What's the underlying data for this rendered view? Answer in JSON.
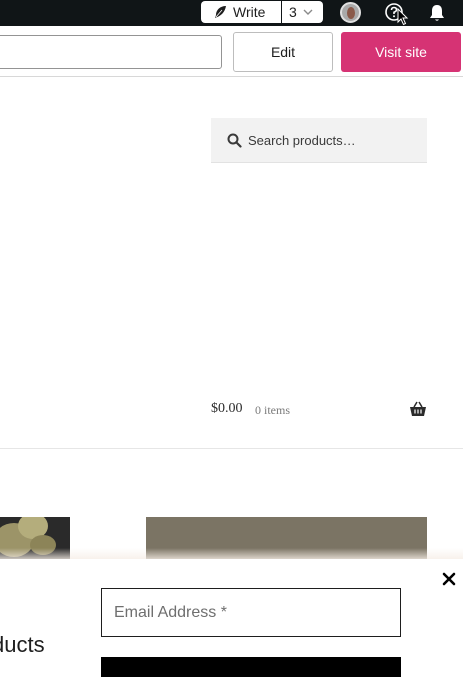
{
  "admin_bar": {
    "write_label": "Write",
    "count_label": "3",
    "icons": [
      "feather-icon",
      "chevron-down-icon",
      "help-icon",
      "bell-icon"
    ]
  },
  "toolbar": {
    "edit_label": "Edit",
    "visit_site_label": "Visit site",
    "accent_color": "#d63374"
  },
  "search": {
    "placeholder": "Search products…"
  },
  "cart": {
    "amount": "$0.00",
    "items": "0 items"
  },
  "popup": {
    "email_placeholder": "Email Address *",
    "heading_fragment": "ducts"
  }
}
